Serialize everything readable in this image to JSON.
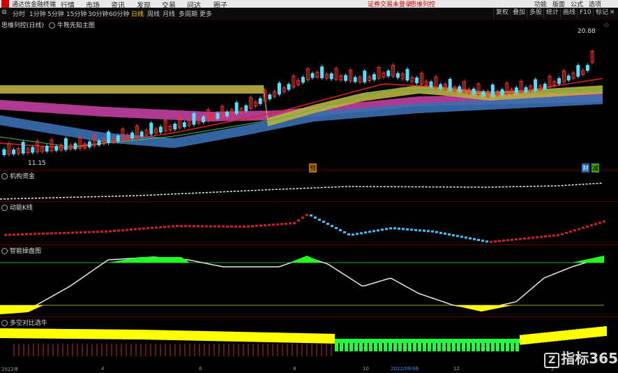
{
  "titlebar": {
    "app": "通达信金融终端",
    "menus": [
      "行情",
      "市场",
      "资讯",
      "发现",
      "交易",
      "问达",
      "圈子"
    ],
    "warn": [
      "证券交易未登录",
      "思维列控"
    ],
    "winbtns": [
      "功能",
      "版面",
      "公式",
      "选项"
    ]
  },
  "toolbar": {
    "periods": [
      "分时",
      "1分钟",
      "5分钟",
      "15分钟",
      "30分钟",
      "60分钟",
      "日线",
      "周线",
      "月线",
      "多周期",
      "更多"
    ],
    "active": "日线",
    "right": [
      "复权",
      "叠加",
      "多股",
      "统计",
      "画线",
      "F10",
      "标记"
    ]
  },
  "main": {
    "title": "思维列控(日线)",
    "indicator": "牛熊先知主图",
    "high_label": "20.88",
    "low_label": "11.15",
    "badges": [
      "预",
      "财",
      "减"
    ]
  },
  "panels": [
    "机构资金",
    "动能K线",
    "智能操盘图",
    "多空对比选牛"
  ],
  "axis_labels": [
    "2022年",
    "4",
    "6",
    "8",
    "10",
    "2022/09/06",
    "12",
    "2"
  ],
  "watermark": "指标365"
}
